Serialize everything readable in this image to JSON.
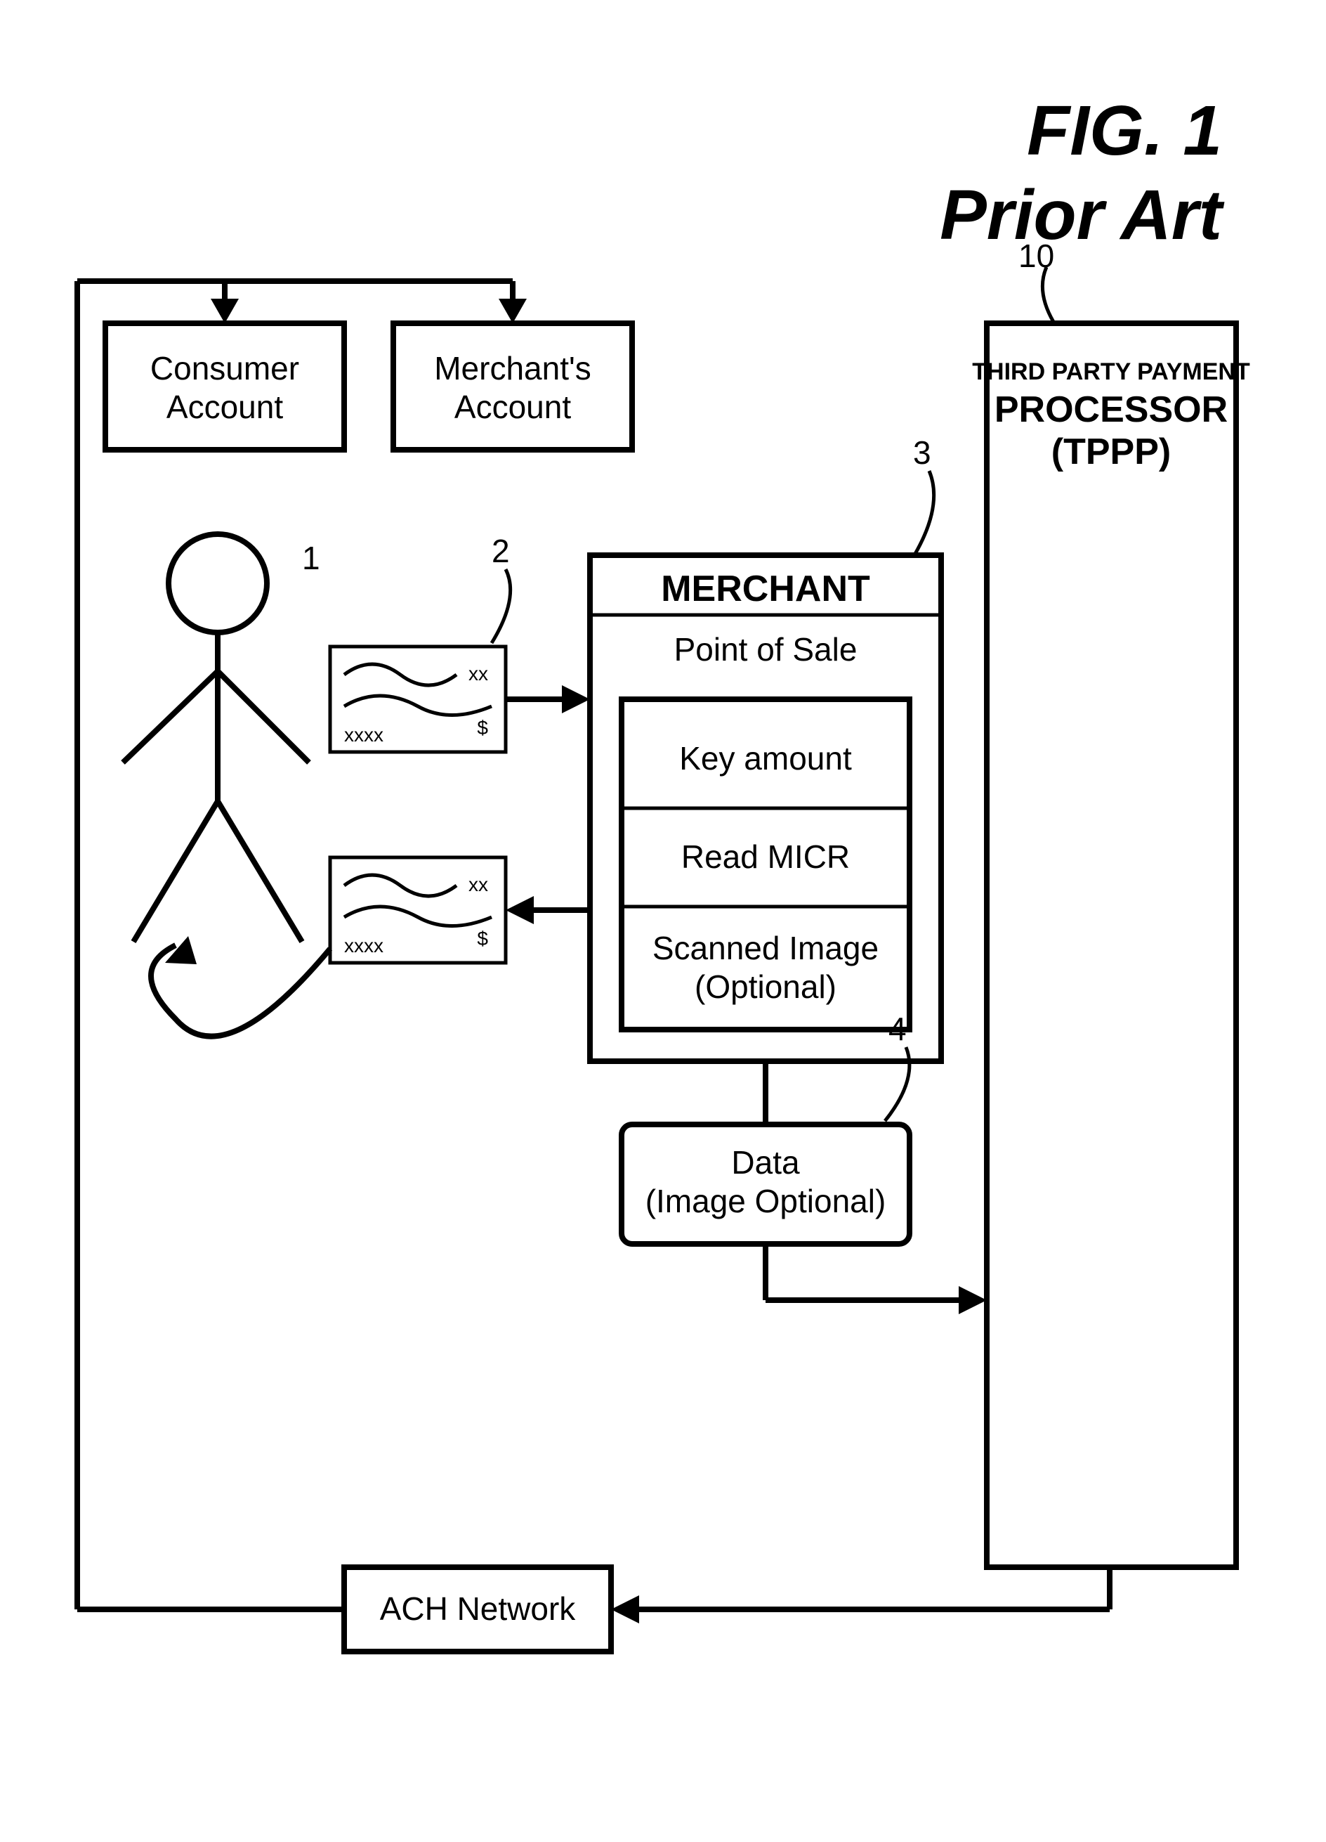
{
  "figure": {
    "label": "FIG. 1",
    "sub": "Prior Art"
  },
  "refs": {
    "consumer_person": "1",
    "check": "2",
    "merchant_box": "3",
    "data_box": "4",
    "tppp_box": "10"
  },
  "consumer_account": "Consumer Account",
  "merchant_account": "Merchant's Account",
  "merchant": {
    "title": "MERCHANT",
    "pos": "Point of Sale",
    "row1": "Key amount",
    "row2": "Read MICR",
    "row3a": "Scanned Image",
    "row3b": "(Optional)"
  },
  "data": {
    "line1": "Data",
    "line2": "(Image Optional)"
  },
  "tppp": {
    "line1": "THIRD PARTY PAYMENT",
    "line2": "PROCESSOR",
    "line3": "(TPPP)"
  },
  "ach": "ACH Network",
  "check_text": {
    "serial": "xxxx",
    "xx": "xx",
    "amount": "$"
  }
}
